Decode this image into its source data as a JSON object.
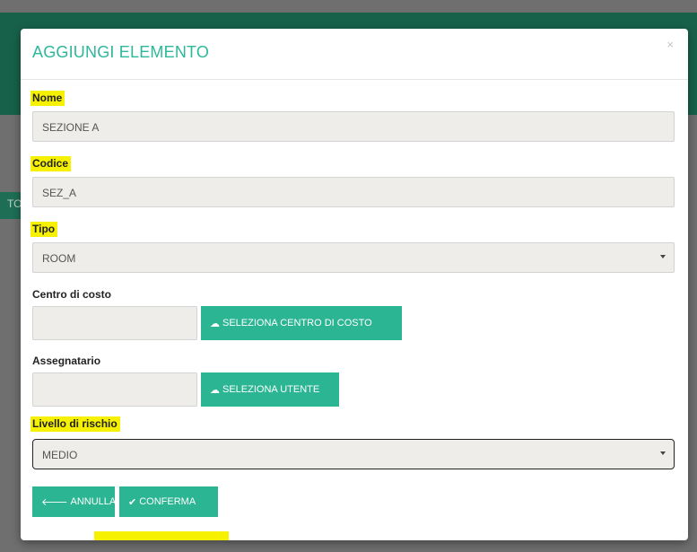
{
  "background": {
    "band_text": "TO"
  },
  "modal": {
    "title": "AGGIUNGI ELEMENTO",
    "close_label": "×",
    "fields": {
      "nome": {
        "label": "Nome",
        "value": "SEZIONE A"
      },
      "codice": {
        "label": "Codice",
        "value": "SEZ_A"
      },
      "tipo": {
        "label": "Tipo",
        "value": "ROOM"
      },
      "centro_costo": {
        "label": "Centro di costo",
        "value": "",
        "button_label": "SELEZIONA CENTRO DI COSTO"
      },
      "assegnatario": {
        "label": "Assegnatario",
        "value": "",
        "button_label": "SELEZIONA UTENTE"
      },
      "rischio": {
        "label": "Livello di rischio",
        "value": "MEDIO"
      }
    },
    "footer": {
      "annulla_label": "ANNULLA",
      "conferma_label": "CONFERMA"
    }
  },
  "colors": {
    "accent": "#2cb593",
    "title": "#2db89a",
    "highlight": "#f6f100",
    "header_bg": "#17614a"
  },
  "icons": {
    "cloud": "cloud-icon",
    "arrow_left": "arrow-left-icon",
    "check": "check-icon",
    "dropdown": "chevron-down-icon"
  }
}
